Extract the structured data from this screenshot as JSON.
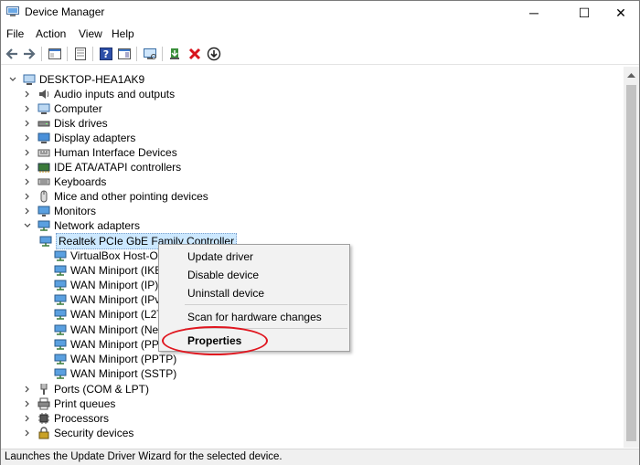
{
  "window": {
    "title": "Device Manager",
    "min_glyph": "─",
    "max_glyph": "☐",
    "close_glyph": "✕"
  },
  "menu": {
    "items": [
      "File",
      "Action",
      "View",
      "Help"
    ]
  },
  "toolbar": {
    "buttons": [
      {
        "name": "back",
        "icon": "back-arrow-icon"
      },
      {
        "name": "forward",
        "icon": "forward-arrow-icon"
      },
      {
        "name": "properties",
        "icon": "properties-icon"
      },
      {
        "name": "show-hide",
        "icon": "console-tree-icon"
      },
      {
        "name": "help",
        "icon": "help-icon"
      },
      {
        "name": "action-pane",
        "icon": "action-pane-icon"
      },
      {
        "name": "scan",
        "icon": "scan-hardware-icon"
      },
      {
        "name": "update-driver",
        "icon": "update-driver-icon"
      },
      {
        "name": "uninstall",
        "icon": "uninstall-icon"
      },
      {
        "name": "disable",
        "icon": "disable-device-icon"
      }
    ]
  },
  "tree": {
    "root": "DESKTOP-HEA1AK9",
    "categories": [
      "Audio inputs and outputs",
      "Computer",
      "Disk drives",
      "Display adapters",
      "Human Interface Devices",
      "IDE ATA/ATAPI controllers",
      "Keyboards",
      "Mice and other pointing devices",
      "Monitors",
      "Network adapters"
    ],
    "network_children": [
      "Realtek PCIe GbE Family Controller",
      "VirtualBox Host-Onl",
      "WAN Miniport (IKEv",
      "WAN Miniport (IP)",
      "WAN Miniport (IPv6",
      "WAN Miniport (L2TP",
      "WAN Miniport (Netw",
      "WAN Miniport (PPP",
      "WAN Miniport (PPTP)",
      "WAN Miniport (SSTP)"
    ],
    "after": [
      "Ports (COM & LPT)",
      "Print queues",
      "Processors",
      "Security devices"
    ]
  },
  "context_menu": {
    "update": "Update driver",
    "disable": "Disable device",
    "uninstall": "Uninstall device",
    "scan": "Scan for hardware changes",
    "properties": "Properties"
  },
  "status": {
    "text": "Launches the Update Driver Wizard for the selected device."
  },
  "colors": {
    "selection": "#cce8ff",
    "highlight_ring": "#e0161f"
  }
}
